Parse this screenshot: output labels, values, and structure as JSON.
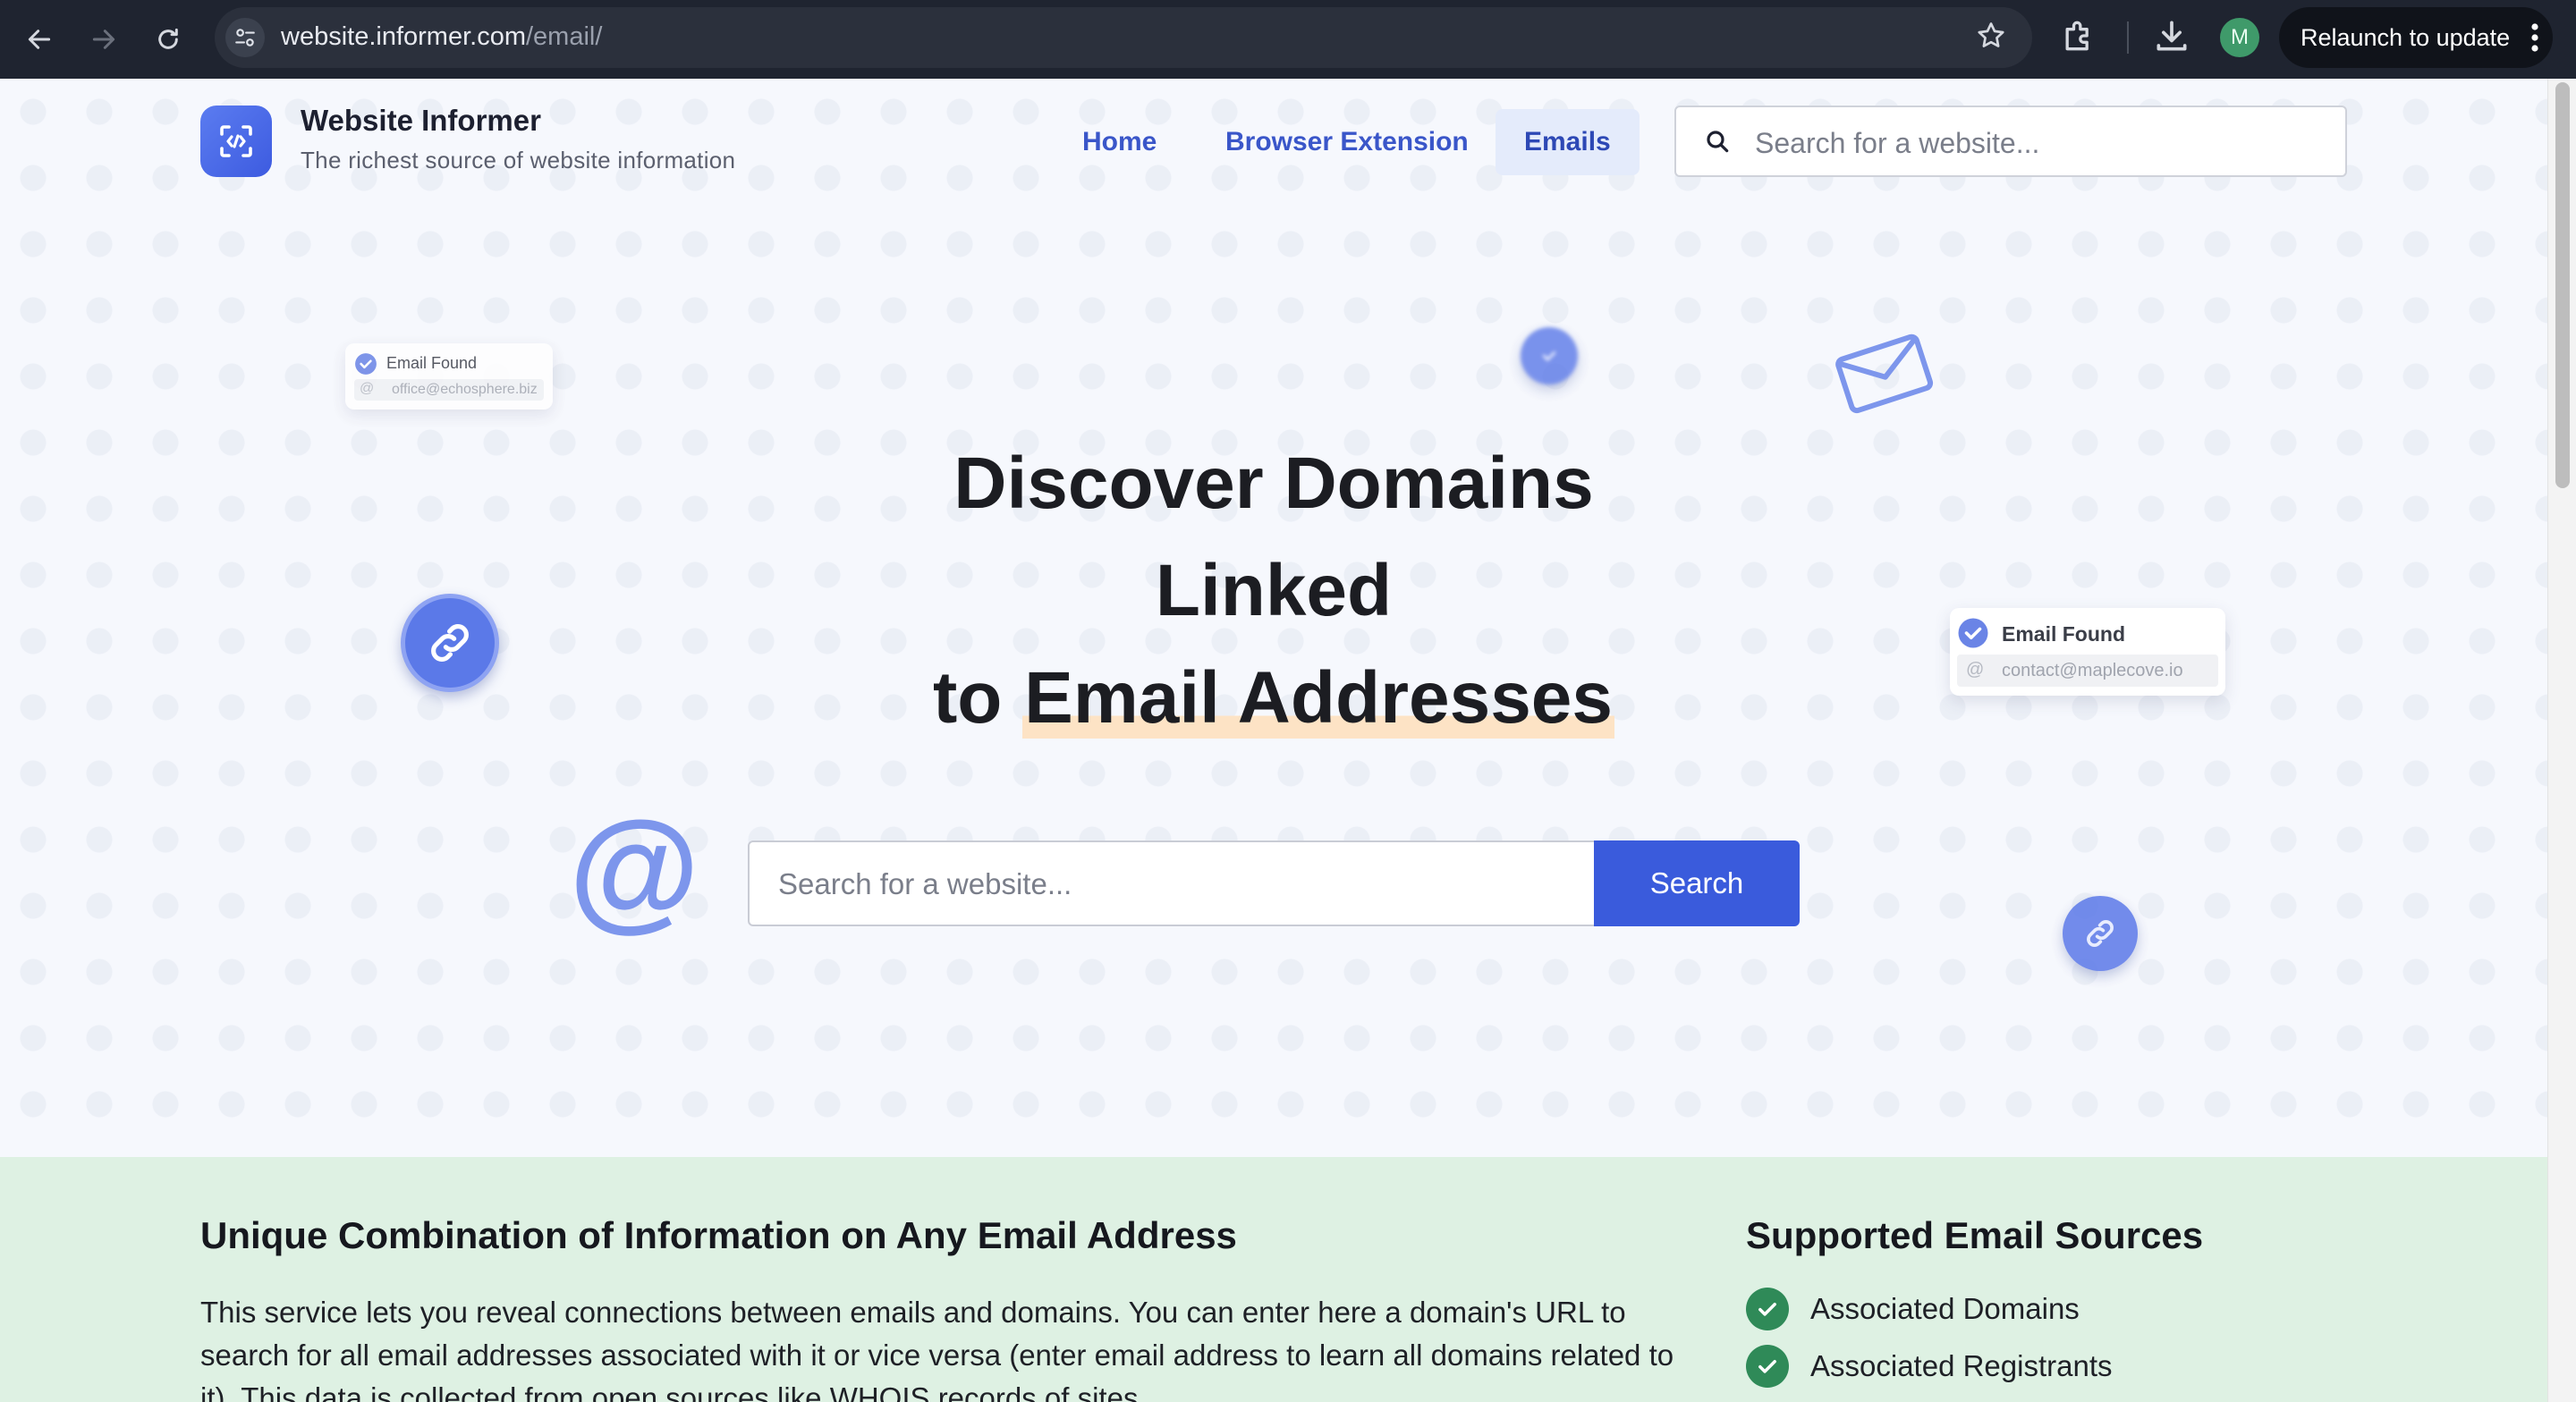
{
  "browser": {
    "url_host": "website.informer.com",
    "url_path": "/email/",
    "avatar_letter": "M",
    "relaunch_label": "Relaunch to update"
  },
  "header": {
    "brand_name": "Website Informer",
    "brand_tagline": "The richest source of website information",
    "nav": {
      "home": "Home",
      "browser_extension": "Browser Extension",
      "emails": "Emails"
    },
    "search_placeholder": "Search for a website..."
  },
  "hero": {
    "title_line1": "Discover Domains",
    "title_line2": "Linked",
    "title_line3_prefix": "to",
    "title_line3_highlight": "Email Addresses",
    "search_placeholder": "Search for a website...",
    "search_button": "Search",
    "card_left": {
      "title": "Email Found",
      "email": "office@echosphere.biz"
    },
    "card_right": {
      "title": "Email Found",
      "email": "contact@maplecove.io"
    }
  },
  "info": {
    "heading": "Unique Combination of Information on Any Email Address",
    "paragraph": "This service lets you reveal connections between emails and domains. You can enter here a domain's URL to search for all email addresses associated with it or vice versa (enter email address to learn all domains related to it). This data is collected from open sources like WHOIS records of sites.",
    "sources_heading": "Supported Email Sources",
    "sources": [
      "Associated Domains",
      "Associated Registrants"
    ]
  },
  "colors": {
    "accent": "#3a5bdc",
    "nav_link": "#3a56c9",
    "info_bg": "#def1e3",
    "check_green": "#2f8a58",
    "highlight": "#fde3c5"
  }
}
